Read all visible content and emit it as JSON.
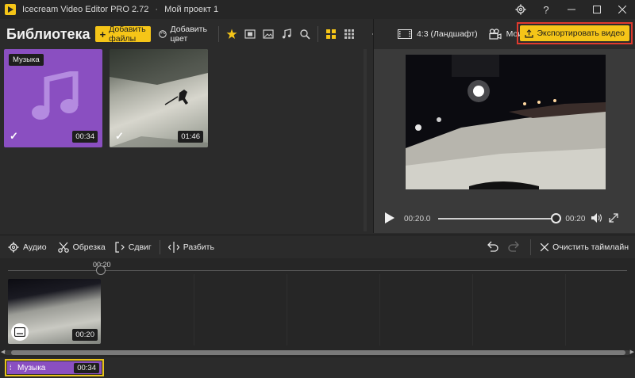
{
  "titlebar": {
    "app_name": "Icecream Video Editor PRO 2.72",
    "separator": "·",
    "project_name": "Мой проект 1"
  },
  "library": {
    "title": "Библиотека",
    "add_files_label": "Добавить файлы",
    "add_color_label": "Добавить цвет",
    "items": [
      {
        "tag": "Музыка",
        "duration": "00:34",
        "type": "music",
        "selected": true
      },
      {
        "tag": "",
        "duration": "01:46",
        "type": "video",
        "selected": true
      }
    ]
  },
  "preview": {
    "aspect_label": "4:3 (Ландшафт)",
    "projects_label": "Мои проекты",
    "export_label": "Экспортировать видео",
    "time_current": "00:20.0",
    "time_total": "00:20",
    "progress": 1.0
  },
  "edit_toolbar": {
    "audio_label": "Аудио",
    "trim_label": "Обрезка",
    "shift_label": "Сдвиг",
    "split_label": "Разбить",
    "clear_label": "Очистить таймлайн"
  },
  "timeline": {
    "ruler_label": "00:20",
    "clip_duration": "00:20"
  },
  "music_track": {
    "label": "Музыка",
    "duration": "00:34"
  },
  "colors": {
    "accent": "#f5c518",
    "music": "#8a4fc1",
    "export_highlight": "#e03a2e"
  }
}
